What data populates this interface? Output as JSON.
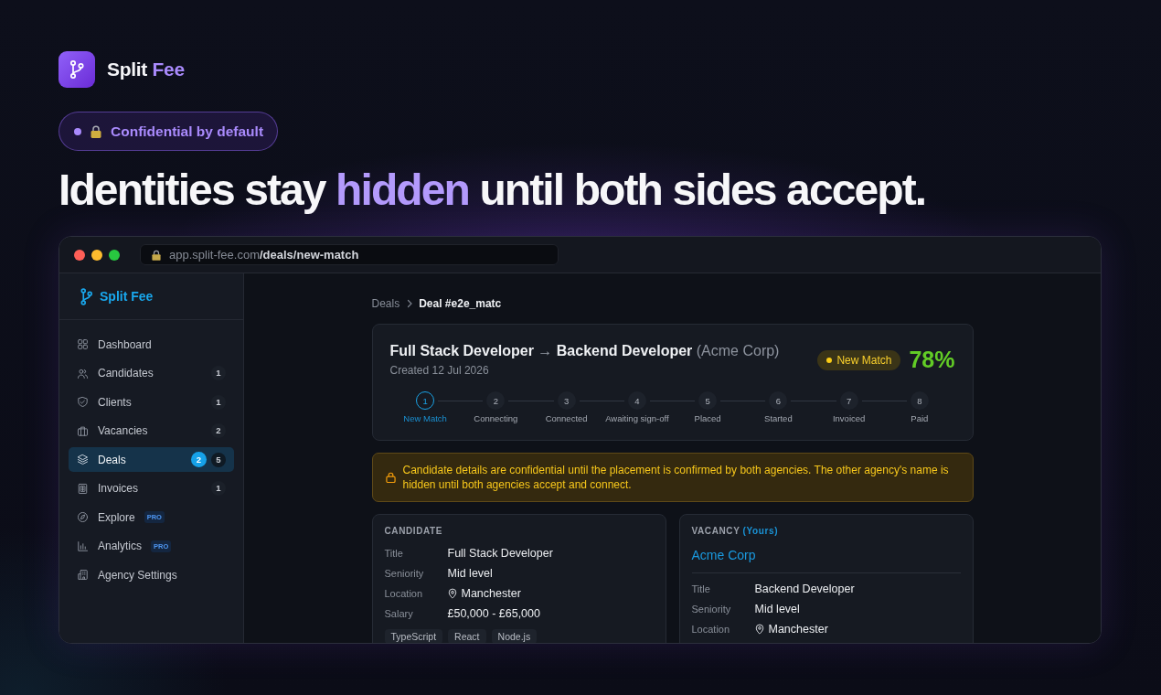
{
  "brand": {
    "word": "Split",
    "accent_word": "Fee"
  },
  "badge": {
    "label": "Confidential by default"
  },
  "headline": {
    "before": "Identities stay ",
    "highlight": "hidden",
    "after": " until both sides accept."
  },
  "browser": {
    "url_host": "app.split-fee.com",
    "url_path": "/deals/new-match"
  },
  "sidebar": {
    "brand": "Split Fee",
    "items": [
      {
        "label": "Dashboard",
        "selected": false
      },
      {
        "label": "Candidates",
        "count": "1",
        "selected": false
      },
      {
        "label": "Clients",
        "count": "1",
        "selected": false
      },
      {
        "label": "Vacancies",
        "count": "2",
        "selected": false
      },
      {
        "label": "Deals",
        "new_count": "2",
        "count": "5",
        "selected": true
      },
      {
        "label": "Invoices",
        "count": "1",
        "selected": false
      },
      {
        "label": "Explore",
        "tag": "PRO",
        "selected": false
      },
      {
        "label": "Analytics",
        "tag": "PRO",
        "selected": false
      },
      {
        "label": "Agency Settings",
        "selected": false
      }
    ]
  },
  "breadcrumb": [
    "Deals",
    "Deal #e2e_matc"
  ],
  "deal": {
    "from_role": "Full Stack Developer",
    "arrow": "→",
    "to_role": "Backend Developer",
    "company": "(Acme Corp)",
    "created": "Created 12 Jul 2026",
    "status": "New Match",
    "score": "78%",
    "steps": [
      {
        "number": "1",
        "label": "New Match",
        "current": true
      },
      {
        "number": "2",
        "label": "Connecting",
        "current": false
      },
      {
        "number": "3",
        "label": "Connected",
        "current": false
      },
      {
        "number": "4",
        "label": "Awaiting sign-off",
        "current": false
      },
      {
        "number": "5",
        "label": "Placed",
        "current": false
      },
      {
        "number": "6",
        "label": "Started",
        "current": false
      },
      {
        "number": "7",
        "label": "Invoiced",
        "current": false
      },
      {
        "number": "8",
        "label": "Paid",
        "current": false
      }
    ]
  },
  "alert": {
    "text": "Candidate details are confidential until the placement is confirmed by both agencies. The other agency's name is hidden until both agencies accept and connect."
  },
  "candidate": {
    "heading": "CANDIDATE",
    "fields": [
      {
        "label": "Title",
        "value": "Full Stack Developer",
        "kind": "text"
      },
      {
        "label": "Seniority",
        "value": "Mid level",
        "kind": "text"
      },
      {
        "label": "Location",
        "value": "Manchester",
        "kind": "location"
      },
      {
        "label": "Salary",
        "value": "£50,000 - £65,000",
        "kind": "text"
      }
    ],
    "skills": [
      "TypeScript",
      "React",
      "Node.js"
    ]
  },
  "vacancy": {
    "heading": "VACANCY",
    "heading_note": "(Yours)",
    "company": "Acme Corp",
    "fields": [
      {
        "label": "Title",
        "value": "Backend Developer",
        "kind": "text"
      },
      {
        "label": "Seniority",
        "value": "Mid level",
        "kind": "text"
      },
      {
        "label": "Location",
        "value": "Manchester",
        "kind": "location"
      }
    ]
  }
}
